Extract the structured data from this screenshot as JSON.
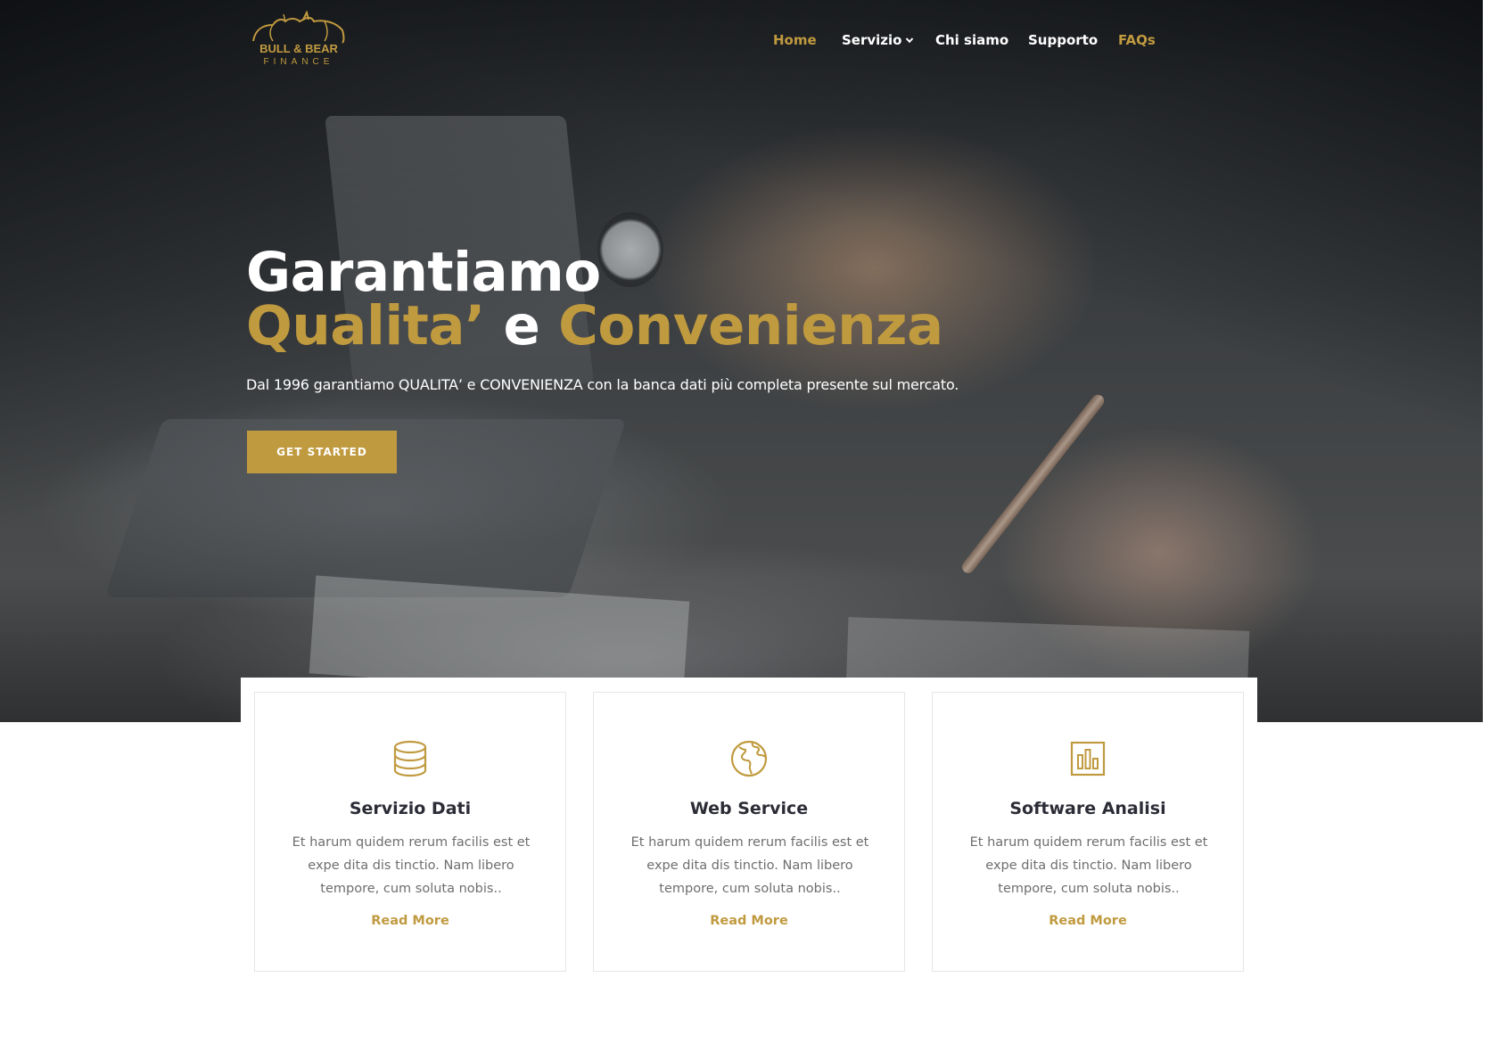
{
  "brand": {
    "logo_line1": "BULL & BEAR",
    "logo_line2": "FINANCE",
    "accent_color": "#c09a3f"
  },
  "nav": {
    "items": [
      {
        "label": "Home"
      },
      {
        "label": "Servizio"
      },
      {
        "label": "Chi siamo"
      },
      {
        "label": "Supporto"
      },
      {
        "label": "FAQs"
      }
    ]
  },
  "hero": {
    "title_line1": "Garantiamo",
    "title_gold1": "Qualita’",
    "title_mid": " e ",
    "title_gold2": "Convenienza",
    "subtitle": "Dal 1996 garantiamo QUALITA’ e CONVENIENZA con la banca dati più completa presente sul mercato.",
    "cta_label": "GET STARTED"
  },
  "services": [
    {
      "icon": "database-icon",
      "title": "Servizio Dati",
      "description": "Et harum quidem rerum facilis est et expe dita dis tinctio. Nam libero tempore, cum soluta nobis..",
      "link": "Read More"
    },
    {
      "icon": "globe-africa-icon",
      "title": "Web Service",
      "description": "Et harum quidem rerum facilis est et expe dita dis tinctio. Nam libero tempore, cum soluta nobis..",
      "link": "Read More"
    },
    {
      "icon": "bar-chart-icon",
      "title": "Software Analisi",
      "description": "Et harum quidem rerum facilis est et expe dita dis tinctio. Nam libero tempore, cum soluta nobis..",
      "link": "Read More"
    }
  ]
}
